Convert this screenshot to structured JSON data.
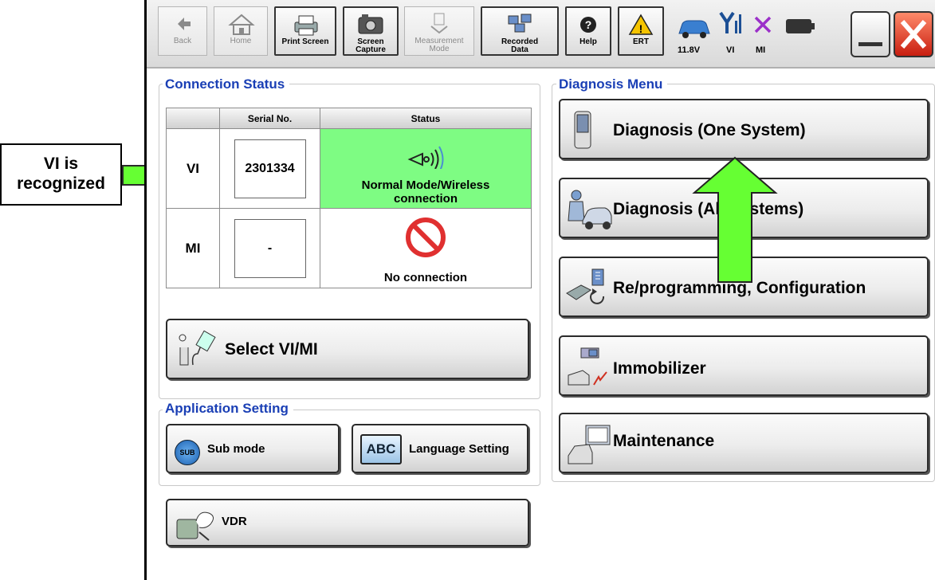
{
  "toolbar": {
    "back": "Back",
    "home": "Home",
    "print_screen": "Print Screen",
    "screen_capture_1": "Screen",
    "screen_capture_2": "Capture",
    "measurement_1": "Measurement",
    "measurement_2": "Mode",
    "recorded_1": "Recorded",
    "recorded_2": "Data",
    "help": "Help",
    "ert": "ERT",
    "voltage": "11.8V",
    "vi": "VI",
    "mi": "MI"
  },
  "connection_status": {
    "title": "Connection Status",
    "col_serial": "Serial No.",
    "col_status": "Status",
    "rows": [
      {
        "label": "VI",
        "serial": "2301334",
        "status_1": "Normal Mode/Wireless",
        "status_2": "connection"
      },
      {
        "label": "MI",
        "serial": "-",
        "status_1": "No connection"
      }
    ],
    "select_button": "Select VI/MI"
  },
  "application_setting": {
    "title": "Application Setting",
    "sub_mode": "Sub mode",
    "sub_icon_text": "SUB",
    "language": "Language Setting",
    "language_icon_text": "ABC"
  },
  "vdr": "VDR",
  "diagnosis_menu": {
    "title": "Diagnosis Menu",
    "items": [
      "Diagnosis (One System)",
      "Diagnosis (All Systems)",
      "Re/programming, Configuration",
      "Immobilizer",
      "Maintenance"
    ]
  },
  "callout": {
    "line1": "VI is",
    "line2": "recognized"
  },
  "colors": {
    "title_blue": "#1a3fb5",
    "ok_green": "#7efc83",
    "arrow_green": "#66ff33",
    "close_red": "#e03020"
  }
}
